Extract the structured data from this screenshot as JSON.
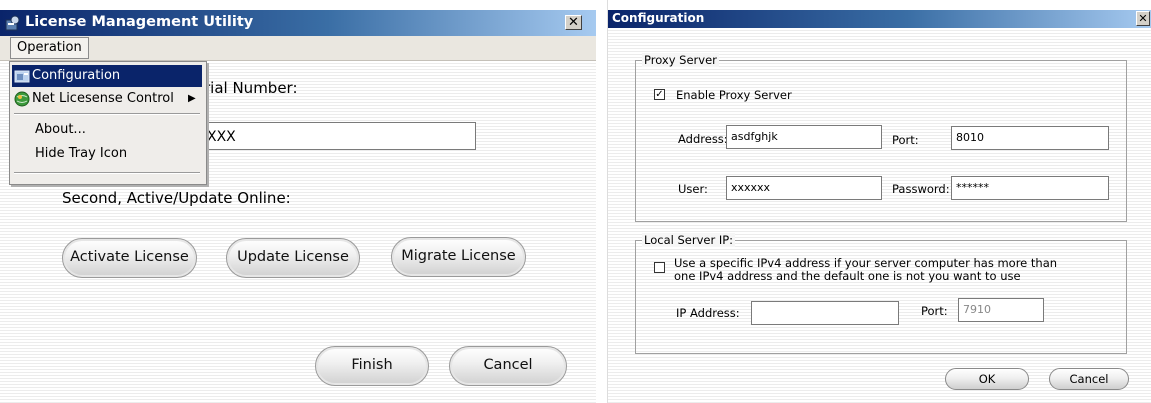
{
  "left_window": {
    "title": "License Management Utility",
    "close_glyph": "✕",
    "menu": {
      "operation": "Operation"
    },
    "popup": {
      "items": [
        {
          "label": "Configuration",
          "icon": "configuration-icon"
        },
        {
          "label": "Net Licesense Control",
          "icon": "globe-icon",
          "submenu_glyph": "▶"
        },
        {
          "label": "About..."
        },
        {
          "label": "Hide Tray Icon"
        }
      ]
    },
    "serial_label": "rial Number:",
    "serial_value": "XXX",
    "second_label": "Second, Active/Update Online:",
    "buttons": {
      "activate": "Activate License",
      "update": "Update License",
      "migrate": "Migrate License",
      "finish": "Finish",
      "cancel": "Cancel"
    }
  },
  "right_window": {
    "title": "Configuration",
    "close_glyph": "✕",
    "proxy": {
      "legend": "Proxy Server",
      "enable_label": "Enable Proxy Server",
      "enable_checked": true,
      "check_glyph": "✓",
      "address_label": "Address:",
      "address_value": "asdfghjk",
      "port_label": "Port:",
      "port_value": "8010",
      "user_label": "User:",
      "user_value": "xxxxxx",
      "password_label": "Password:",
      "password_value": "******"
    },
    "local": {
      "legend": "Local Server IP:",
      "checkbox_label_line1": "Use a specific IPv4 address if your server computer has more than",
      "checkbox_label_line2": "one IPv4 address and the default one is not you want to use",
      "checked": false,
      "ip_label": "IP Address:",
      "ip_value": "",
      "port_label": "Port:",
      "port_value": "7910"
    },
    "buttons": {
      "ok": "OK",
      "cancel": "Cancel"
    }
  },
  "colors": {
    "title_start": "#0a246a",
    "title_end": "#a6caf0",
    "menu_highlight": "#0a246a"
  }
}
